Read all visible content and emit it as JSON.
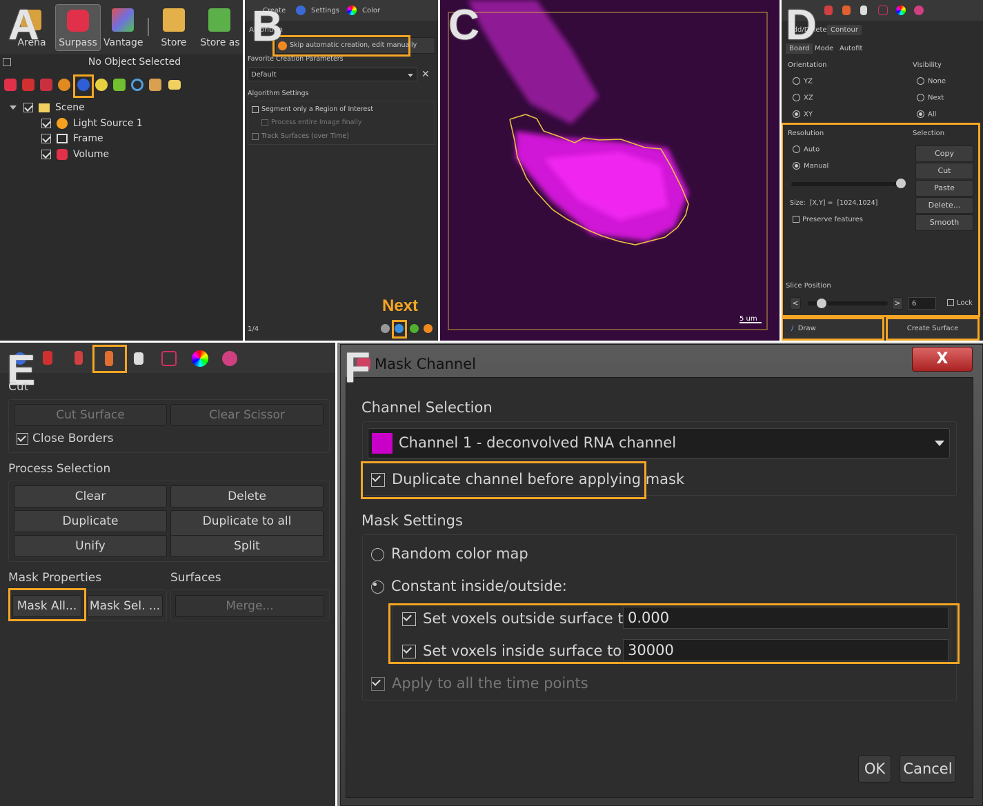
{
  "panel_letters": {
    "a": "A",
    "b": "B",
    "c": "C",
    "d": "D",
    "e": "E",
    "f": "F"
  },
  "panelA": {
    "toolbar": [
      "Arena",
      "Surpass",
      "Vantage",
      "Store",
      "Store as"
    ],
    "status": "No Object Selected",
    "tree": [
      "Scene",
      "Light Source 1",
      "Frame",
      "Volume"
    ]
  },
  "panelB": {
    "tabs": [
      "Create",
      "Settings",
      "Color"
    ],
    "algorithm_label": "Algorithm",
    "skip_button": "Skip automatic creation, edit manually",
    "favorite_label": "Favorite Creation Parameters",
    "default_value": "Default",
    "algo_settings": "Algorithm Settings",
    "opt1": "Segment only a Region of Interest",
    "opt2": "Process entire Image finally",
    "opt3": "Track Surfaces (over Time)",
    "page": "1/4",
    "next": "Next"
  },
  "panelC": {
    "scale": "5 um"
  },
  "panelD": {
    "tabs1": [
      "Add/Delete",
      "Contour"
    ],
    "tabs2": [
      "Board",
      "Mode",
      "Autofit"
    ],
    "orientation": "Orientation",
    "visibility": "Visibility",
    "orient_opts": [
      "YZ",
      "XZ",
      "XY"
    ],
    "vis_opts": [
      "None",
      "Next",
      "All"
    ],
    "resolution": "Resolution",
    "selection": "Selection",
    "res_opts": [
      "Auto",
      "Manual"
    ],
    "sel_buttons": [
      "Copy",
      "Cut",
      "Paste",
      "Delete...",
      "Smooth"
    ],
    "size_label": "Size:",
    "size_xy": "[X,Y] =",
    "size_val": "[1024,1024]",
    "preserve": "Preserve features",
    "slice": "Slice Position",
    "slice_val": "6",
    "lock": "Lock",
    "draw": "Draw",
    "create": "Create Surface"
  },
  "panelE": {
    "cut": "Cut",
    "cut_surface": "Cut Surface",
    "clear_scissor": "Clear Scissor",
    "close_borders": "Close Borders",
    "process_selection": "Process Selection",
    "clear": "Clear",
    "delete": "Delete",
    "duplicate": "Duplicate",
    "dup_all": "Duplicate to all Timepoints",
    "unify": "Unify",
    "split": "Split",
    "mask_props": "Mask Properties",
    "surfaces": "Surfaces",
    "mask_all": "Mask All...",
    "mask_sel": "Mask Sel. ...",
    "merge": "Merge..."
  },
  "panelF": {
    "title": "Mask Channel",
    "close": "X",
    "channel_selection": "Channel Selection",
    "channel": "Channel 1 - deconvolved RNA channel",
    "channel_color": "#c800c8",
    "duplicate": "Duplicate channel before applying mask",
    "mask_settings": "Mask Settings",
    "random": "Random color map",
    "constant": "Constant inside/outside:",
    "outside_label": "Set voxels outside surface to:",
    "outside_val": "0.000",
    "inside_label": "Set voxels inside surface to:",
    "inside_val": "30000",
    "apply": "Apply to all the time points",
    "ok": "OK",
    "cancel": "Cancel"
  },
  "accent": "#f5a623"
}
